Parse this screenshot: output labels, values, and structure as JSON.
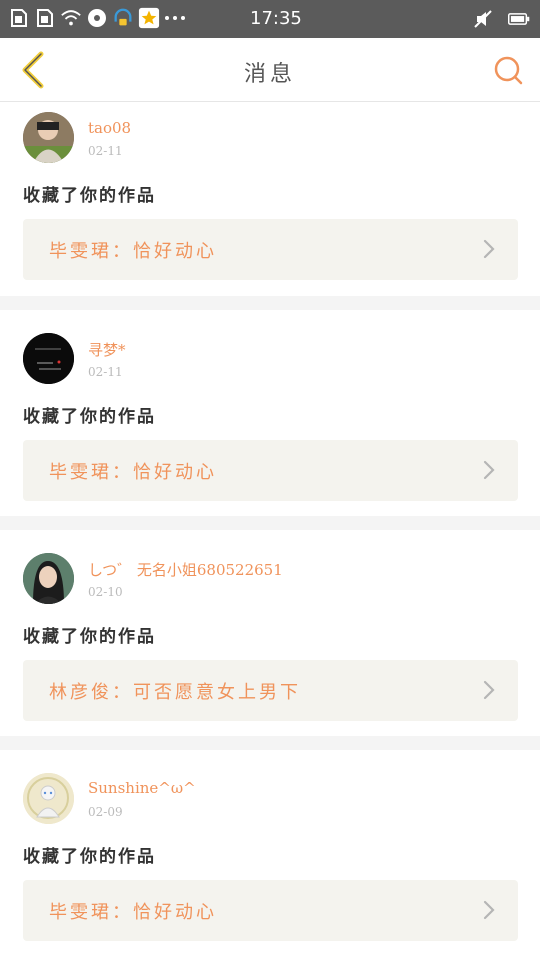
{
  "status_bar": {
    "time": "17:35",
    "left_icons": [
      "sim-card-icon",
      "sim-card-icon",
      "wifi-icon",
      "sync-icon",
      "headphones-icon",
      "star-app-icon",
      "more-dots-icon"
    ],
    "right_icons": [
      "mute-icon",
      "battery-icon"
    ]
  },
  "header": {
    "title": "消息",
    "back_icon": "chevron-left-icon",
    "search_icon": "search-icon"
  },
  "messages": [
    {
      "user": "tao08",
      "date": "02-11",
      "action": "收藏了你的作品",
      "work": "毕雯珺：恰好动心"
    },
    {
      "user": "寻梦*",
      "date": "02-11",
      "action": "收藏了你的作品",
      "work": "毕雯珺：恰好动心"
    },
    {
      "user": "しつ゛ 无名小姐680522651",
      "date": "02-10",
      "action": "收藏了你的作品",
      "work": "林彦俊：可否愿意女上男下"
    },
    {
      "user": "Sunshine^ω^",
      "date": "02-09",
      "action": "收藏了你的作品",
      "work": "毕雯珺：恰好动心"
    }
  ],
  "colors": {
    "accent": "#f0935b",
    "status_bar": "#5b5b5b",
    "card_bg": "#f4f3ee",
    "divider": "#f4f4f4"
  }
}
